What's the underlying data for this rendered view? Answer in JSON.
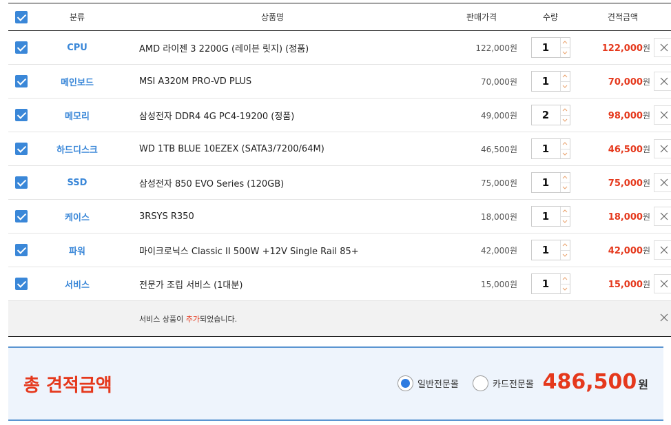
{
  "header": {
    "category": "분류",
    "product": "상품명",
    "price": "판매가격",
    "qty": "수량",
    "total": "견적금액"
  },
  "items": [
    {
      "category": "CPU",
      "name": "AMD 라이젠 3 2200G (레이븐 릿지) (정품)",
      "price": "122,000",
      "qty": "1",
      "total": "122,000"
    },
    {
      "category": "메인보드",
      "name": "MSI A320M PRO-VD PLUS",
      "price": "70,000",
      "qty": "1",
      "total": "70,000"
    },
    {
      "category": "메모리",
      "name": "삼성전자 DDR4 4G PC4-19200 (정품)",
      "price": "49,000",
      "qty": "2",
      "total": "98,000"
    },
    {
      "category": "하드디스크",
      "name": "WD 1TB BLUE 10EZEX (SATA3/7200/64M)",
      "price": "46,500",
      "qty": "1",
      "total": "46,500"
    },
    {
      "category": "SSD",
      "name": "삼성전자 850 EVO Series (120GB)",
      "price": "75,000",
      "qty": "1",
      "total": "75,000"
    },
    {
      "category": "케이스",
      "name": "3RSYS R350",
      "price": "18,000",
      "qty": "1",
      "total": "18,000"
    },
    {
      "category": "파워",
      "name": "마이크로닉스 Classic II 500W +12V Single Rail 85+",
      "price": "42,000",
      "qty": "1",
      "total": "42,000"
    },
    {
      "category": "서비스",
      "name": "전문가 조립 서비스 (1대분)",
      "price": "15,000",
      "qty": "1",
      "total": "15,000"
    }
  ],
  "currency": "원",
  "notice": {
    "before": "서비스 상품이 ",
    "highlight": "추가",
    "after": "되었습니다."
  },
  "summary": {
    "label": "총 견적금액",
    "option_normal": "일반전문몰",
    "option_card": "카드전문몰",
    "selected_option": "일반전문몰",
    "amount": "486,500",
    "currency": "원"
  },
  "colors": {
    "accent": "#3a87d8",
    "price_red": "#e5381c",
    "summary_bg": "#eef4fc"
  },
  "icons": {
    "checkbox": "checkbox-checked-icon",
    "delete": "close-icon",
    "qty_up": "chevron-up-icon",
    "qty_down": "chevron-down-icon"
  }
}
